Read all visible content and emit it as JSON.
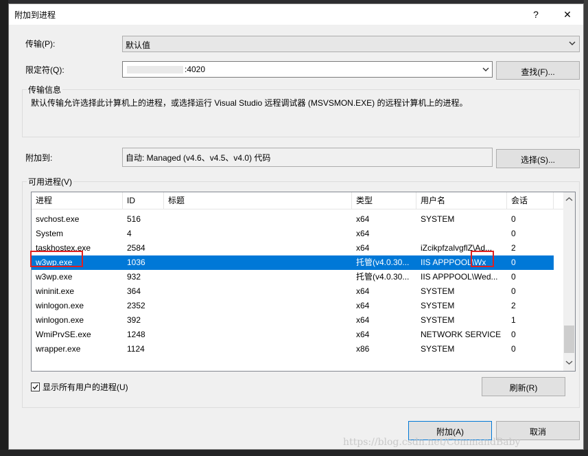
{
  "dialog": {
    "title": "附加到进程",
    "help": "?",
    "close": "✕"
  },
  "transport": {
    "label": "传输(P):",
    "value": "默认值"
  },
  "qualifier": {
    "label": "限定符(Q):",
    "value": ":4020",
    "find_button": "查找(F)..."
  },
  "transport_info": {
    "group_label": "传输信息",
    "text": "默认传输允许选择此计算机上的进程，或选择运行 Visual Studio 远程调试器 (MSVSMON.EXE) 的远程计算机上的进程。"
  },
  "attach_to": {
    "label": "附加到:",
    "value": "自动: Managed (v4.6、v4.5、v4.0) 代码",
    "select_button": "选择(S)..."
  },
  "processes": {
    "group_label": "可用进程(V)",
    "columns": [
      "进程",
      "ID",
      "标题",
      "类型",
      "用户名",
      "会话"
    ],
    "rows": [
      {
        "name": "svchost.exe",
        "id": "516",
        "title": "",
        "type": "x64",
        "user": "SYSTEM",
        "session": "0"
      },
      {
        "name": "System",
        "id": "4",
        "title": "",
        "type": "x64",
        "user": "",
        "session": "0"
      },
      {
        "name": "taskhostex.exe",
        "id": "2584",
        "title": "",
        "type": "x64",
        "user": "iZcikpfzalvgflZ\\Ad...",
        "session": "2"
      },
      {
        "name": "w3wp.exe",
        "id": "1036",
        "title": "",
        "type": "托管(v4.0.30...",
        "user": "IIS APPPOOL\\Wx",
        "session": "0"
      },
      {
        "name": "w3wp.exe",
        "id": "932",
        "title": "",
        "type": "托管(v4.0.30...",
        "user": "IIS APPPOOL\\Wed...",
        "session": "0"
      },
      {
        "name": "wininit.exe",
        "id": "364",
        "title": "",
        "type": "x64",
        "user": "SYSTEM",
        "session": "0"
      },
      {
        "name": "winlogon.exe",
        "id": "2352",
        "title": "",
        "type": "x64",
        "user": "SYSTEM",
        "session": "2"
      },
      {
        "name": "winlogon.exe",
        "id": "392",
        "title": "",
        "type": "x64",
        "user": "SYSTEM",
        "session": "1"
      },
      {
        "name": "WmiPrvSE.exe",
        "id": "1248",
        "title": "",
        "type": "x64",
        "user": "NETWORK SERVICE",
        "session": "0"
      },
      {
        "name": "wrapper.exe",
        "id": "1124",
        "title": "",
        "type": "x86",
        "user": "SYSTEM",
        "session": "0"
      }
    ],
    "selected_index": 3
  },
  "show_all_users": {
    "label": "显示所有用户的进程(U)",
    "checked": true
  },
  "refresh_button": "刷新(R)",
  "attach_button": "附加(A)",
  "cancel_button": "取消",
  "watermark": "https://blog.csdn.net/CommandBaby",
  "colors": {
    "selection": "#0078d7",
    "highlight_box": "#e02020",
    "dialog_bg": "#f0f0f0"
  }
}
